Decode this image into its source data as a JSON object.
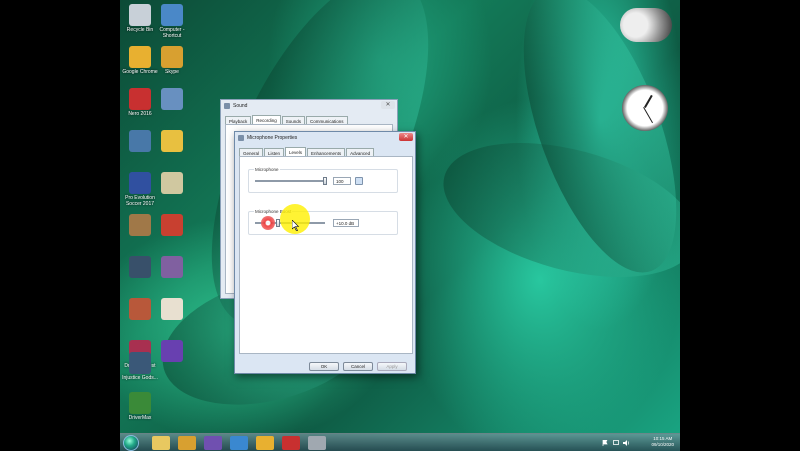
{
  "desktop_icons": [
    {
      "label": "Recycle Bin",
      "color": "#c8d0d8"
    },
    {
      "label": "Computer - Shortcut",
      "color": "#4a88c8"
    },
    {
      "label": "Google Chrome",
      "color": "#e8b030"
    },
    {
      "label": "Skype",
      "color": "#d8a030"
    },
    {
      "label": "Nero 2016",
      "color": "#c83030"
    },
    {
      "label": "",
      "color": "#6890c0"
    },
    {
      "label": "",
      "color": "#4878a8"
    },
    {
      "label": "",
      "color": "#e8c040"
    },
    {
      "label": "Pro Evolution Soccer 2017",
      "color": "#3050a0"
    },
    {
      "label": "",
      "color": "#d0c8a0"
    },
    {
      "label": "",
      "color": "#a07848"
    },
    {
      "label": "",
      "color": "#c84030"
    },
    {
      "label": "",
      "color": "#38506a"
    },
    {
      "label": "",
      "color": "#8060a0"
    },
    {
      "label": "",
      "color": "#b8583a"
    },
    {
      "label": "",
      "color": "#e8e0d0"
    },
    {
      "label": "Dragon Quest",
      "color": "#a83050"
    },
    {
      "label": "",
      "color": "#6840b0"
    },
    {
      "label": "",
      "color": "#e8c860"
    },
    {
      "label": "",
      "color": "#e8c860"
    },
    {
      "label": "Injustice Gods...",
      "color": "#3a5878"
    },
    {
      "label": "DriverMax",
      "color": "#3a8a38"
    }
  ],
  "background_window": {
    "title": "Sound",
    "tabs": [
      "Playback",
      "Recording",
      "Sounds",
      "Communications"
    ],
    "active_tab": "Recording"
  },
  "dialog": {
    "title": "Microphone Properties",
    "close_glyph": "✕",
    "tabs": [
      "General",
      "Listen",
      "Levels",
      "Enhancements",
      "Advanced"
    ],
    "active_tab": "Levels",
    "microphone": {
      "label": "Microphone",
      "value": "100",
      "level": 1.0
    },
    "boost": {
      "label": "Microphone Boost",
      "value": "+10.0 dB",
      "level": 0.33
    },
    "buttons": {
      "ok": "OK",
      "cancel": "Cancel",
      "apply": "Apply"
    }
  },
  "taskbar": {
    "time": "10:15 AM",
    "date": "09/10/2020",
    "apps": [
      {
        "name": "folder-icon",
        "color": "#e8c860"
      },
      {
        "name": "media-player-icon",
        "color": "#d8a030"
      },
      {
        "name": "visual-studio-icon",
        "color": "#7050b0"
      },
      {
        "name": "ie-icon",
        "color": "#3a88d0"
      },
      {
        "name": "chrome-icon",
        "color": "#e8b030"
      },
      {
        "name": "app-icon",
        "color": "#c83030"
      },
      {
        "name": "control-panel-icon",
        "color": "#a0a8b0"
      }
    ]
  },
  "accent_colors": {
    "highlight": "#ffef00",
    "close": "#cc3333"
  }
}
